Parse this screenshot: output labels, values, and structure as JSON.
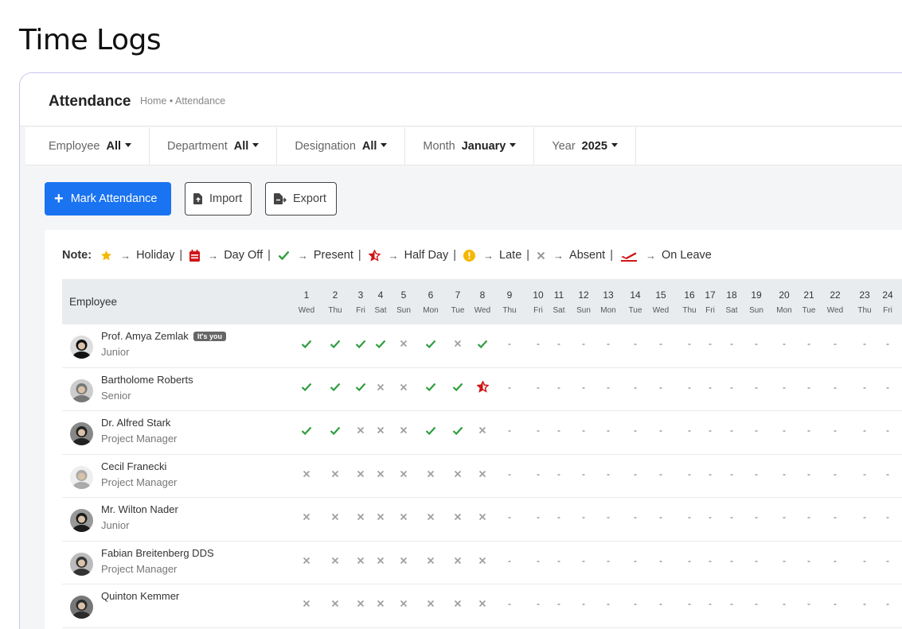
{
  "page_title": "Time Logs",
  "header": {
    "title": "Attendance",
    "breadcrumb": "Home • Attendance"
  },
  "filters": [
    {
      "label": "Employee",
      "value": "All"
    },
    {
      "label": "Department",
      "value": "All"
    },
    {
      "label": "Designation",
      "value": "All"
    },
    {
      "label": "Month",
      "value": "January"
    },
    {
      "label": "Year",
      "value": "2025"
    }
  ],
  "actions": {
    "mark": "Mark Attendance",
    "import": "Import",
    "export": "Export"
  },
  "note": {
    "label": "Note:",
    "items": [
      "Holiday",
      "Day Off",
      "Present",
      "Half Day",
      "Late",
      "Absent",
      "On Leave"
    ]
  },
  "colors": {
    "primary": "#1a73f0",
    "present": "#2e9e3e",
    "absent": "#a0a0a0",
    "half": "#d01616",
    "holiday": "#f5b800",
    "late": "#f5b800",
    "leave": "#d01616"
  },
  "table": {
    "employee_header": "Employee",
    "days": [
      {
        "n": "1",
        "d": "Wed"
      },
      {
        "n": "2",
        "d": "Thu"
      },
      {
        "n": "3",
        "d": "Fri"
      },
      {
        "n": "4",
        "d": "Sat"
      },
      {
        "n": "5",
        "d": "Sun"
      },
      {
        "n": "6",
        "d": "Mon"
      },
      {
        "n": "7",
        "d": "Tue"
      },
      {
        "n": "8",
        "d": "Wed"
      },
      {
        "n": "9",
        "d": "Thu"
      },
      {
        "n": "10",
        "d": "Fri"
      },
      {
        "n": "11",
        "d": "Sat"
      },
      {
        "n": "12",
        "d": "Sun"
      },
      {
        "n": "13",
        "d": "Mon"
      },
      {
        "n": "14",
        "d": "Tue"
      },
      {
        "n": "15",
        "d": "Wed"
      },
      {
        "n": "16",
        "d": "Thu"
      },
      {
        "n": "17",
        "d": "Fri"
      },
      {
        "n": "18",
        "d": "Sat"
      },
      {
        "n": "19",
        "d": "Sun"
      },
      {
        "n": "20",
        "d": "Mon"
      },
      {
        "n": "21",
        "d": "Tue"
      },
      {
        "n": "22",
        "d": "Wed"
      },
      {
        "n": "23",
        "d": "Thu"
      },
      {
        "n": "24",
        "d": "Fri"
      }
    ],
    "rows": [
      {
        "name": "Prof. Amya Zemlak",
        "badge": "It's you",
        "role": "Junior",
        "marks": [
          "P",
          "P",
          "P",
          "P",
          "A",
          "P",
          "A",
          "P"
        ]
      },
      {
        "name": "Bartholome Roberts",
        "role": "Senior",
        "marks": [
          "P",
          "P",
          "P",
          "A",
          "A",
          "P",
          "P",
          "H"
        ]
      },
      {
        "name": "Dr. Alfred Stark",
        "role": "Project Manager",
        "marks": [
          "P",
          "P",
          "A",
          "A",
          "A",
          "P",
          "P",
          "A"
        ]
      },
      {
        "name": "Cecil Franecki",
        "role": "Project Manager",
        "marks": [
          "A",
          "A",
          "A",
          "A",
          "A",
          "A",
          "A",
          "A"
        ]
      },
      {
        "name": "Mr. Wilton Nader",
        "role": "Junior",
        "marks": [
          "A",
          "A",
          "A",
          "A",
          "A",
          "A",
          "A",
          "A"
        ]
      },
      {
        "name": "Fabian Breitenberg DDS",
        "role": "Project Manager",
        "marks": [
          "A",
          "A",
          "A",
          "A",
          "A",
          "A",
          "A",
          "A"
        ]
      },
      {
        "name": "Quinton Kemmer",
        "role": "",
        "marks": [
          "A",
          "A",
          "A",
          "A",
          "A",
          "A",
          "A",
          "A"
        ]
      }
    ]
  }
}
